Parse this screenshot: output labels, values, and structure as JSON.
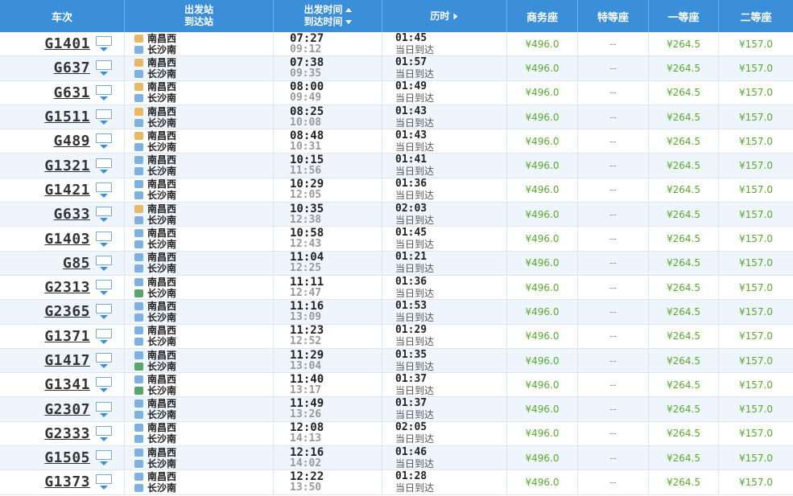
{
  "headers": {
    "train": "车次",
    "stations_from": "出发站",
    "stations_to": "到达站",
    "time_dep": "出发时间",
    "time_arr": "到达时间",
    "duration": "历时",
    "business": "商务座",
    "special": "特等座",
    "first": "一等座",
    "second": "二等座"
  },
  "icons": {
    "info": "train-info-icon",
    "sort_up": "sort-up-icon",
    "sort_down": "sort-down-icon",
    "station_badge": "station-badge-icon"
  },
  "colors": {
    "header_bg": "#3a8fd8",
    "price_green": "#5aa832",
    "start_badge": "#e8b866",
    "pass_badge": "#7fb1e0",
    "end_badge": "#5aa36a"
  },
  "rows": [
    {
      "train": "G1401",
      "from": "南昌西",
      "from_type": "start",
      "to": "长沙南",
      "to_type": "pass",
      "dep": "07:27",
      "arr": "09:12",
      "dur": "01:45",
      "note": "当日到达",
      "business": "¥496.0",
      "special": "--",
      "first": "¥264.5",
      "second": "¥157.0"
    },
    {
      "train": "G637",
      "from": "南昌西",
      "from_type": "start",
      "to": "长沙南",
      "to_type": "pass",
      "dep": "07:38",
      "arr": "09:35",
      "dur": "01:57",
      "note": "当日到达",
      "business": "¥496.0",
      "special": "--",
      "first": "¥264.5",
      "second": "¥157.0"
    },
    {
      "train": "G631",
      "from": "南昌西",
      "from_type": "start",
      "to": "长沙南",
      "to_type": "pass",
      "dep": "08:00",
      "arr": "09:49",
      "dur": "01:49",
      "note": "当日到达",
      "business": "¥496.0",
      "special": "--",
      "first": "¥264.5",
      "second": "¥157.0"
    },
    {
      "train": "G1511",
      "from": "南昌西",
      "from_type": "start",
      "to": "长沙南",
      "to_type": "pass",
      "dep": "08:25",
      "arr": "10:08",
      "dur": "01:43",
      "note": "当日到达",
      "business": "¥496.0",
      "special": "--",
      "first": "¥264.5",
      "second": "¥157.0"
    },
    {
      "train": "G489",
      "from": "南昌西",
      "from_type": "start",
      "to": "长沙南",
      "to_type": "pass",
      "dep": "08:48",
      "arr": "10:31",
      "dur": "01:43",
      "note": "当日到达",
      "business": "¥496.0",
      "special": "--",
      "first": "¥264.5",
      "second": "¥157.0"
    },
    {
      "train": "G1321",
      "from": "南昌西",
      "from_type": "pass",
      "to": "长沙南",
      "to_type": "pass",
      "dep": "10:15",
      "arr": "11:56",
      "dur": "01:41",
      "note": "当日到达",
      "business": "¥496.0",
      "special": "--",
      "first": "¥264.5",
      "second": "¥157.0"
    },
    {
      "train": "G1421",
      "from": "南昌西",
      "from_type": "pass",
      "to": "长沙南",
      "to_type": "pass",
      "dep": "10:29",
      "arr": "12:05",
      "dur": "01:36",
      "note": "当日到达",
      "business": "¥496.0",
      "special": "--",
      "first": "¥264.5",
      "second": "¥157.0"
    },
    {
      "train": "G633",
      "from": "南昌西",
      "from_type": "start",
      "to": "长沙南",
      "to_type": "pass",
      "dep": "10:35",
      "arr": "12:38",
      "dur": "02:03",
      "note": "当日到达",
      "business": "¥496.0",
      "special": "--",
      "first": "¥264.5",
      "second": "¥157.0"
    },
    {
      "train": "G1403",
      "from": "南昌西",
      "from_type": "pass",
      "to": "长沙南",
      "to_type": "pass",
      "dep": "10:58",
      "arr": "12:43",
      "dur": "01:45",
      "note": "当日到达",
      "business": "¥496.0",
      "special": "--",
      "first": "¥264.5",
      "second": "¥157.0"
    },
    {
      "train": "G85",
      "from": "南昌西",
      "from_type": "pass",
      "to": "长沙南",
      "to_type": "pass",
      "dep": "11:04",
      "arr": "12:25",
      "dur": "01:21",
      "note": "当日到达",
      "business": "¥496.0",
      "special": "--",
      "first": "¥264.5",
      "second": "¥157.0"
    },
    {
      "train": "G2313",
      "from": "南昌西",
      "from_type": "pass",
      "to": "长沙南",
      "to_type": "end",
      "dep": "11:11",
      "arr": "12:47",
      "dur": "01:36",
      "note": "当日到达",
      "business": "¥496.0",
      "special": "--",
      "first": "¥264.5",
      "second": "¥157.0"
    },
    {
      "train": "G2365",
      "from": "南昌西",
      "from_type": "pass",
      "to": "长沙南",
      "to_type": "pass",
      "dep": "11:16",
      "arr": "13:09",
      "dur": "01:53",
      "note": "当日到达",
      "business": "¥496.0",
      "special": "--",
      "first": "¥264.5",
      "second": "¥157.0"
    },
    {
      "train": "G1371",
      "from": "南昌西",
      "from_type": "pass",
      "to": "长沙南",
      "to_type": "pass",
      "dep": "11:23",
      "arr": "12:52",
      "dur": "01:29",
      "note": "当日到达",
      "business": "¥496.0",
      "special": "--",
      "first": "¥264.5",
      "second": "¥157.0"
    },
    {
      "train": "G1417",
      "from": "南昌西",
      "from_type": "pass",
      "to": "长沙南",
      "to_type": "end",
      "dep": "11:29",
      "arr": "13:04",
      "dur": "01:35",
      "note": "当日到达",
      "business": "¥496.0",
      "special": "--",
      "first": "¥264.5",
      "second": "¥157.0"
    },
    {
      "train": "G1341",
      "from": "南昌西",
      "from_type": "pass",
      "to": "长沙南",
      "to_type": "end",
      "dep": "11:40",
      "arr": "13:17",
      "dur": "01:37",
      "note": "当日到达",
      "business": "¥496.0",
      "special": "--",
      "first": "¥264.5",
      "second": "¥157.0"
    },
    {
      "train": "G2307",
      "from": "南昌西",
      "from_type": "pass",
      "to": "长沙南",
      "to_type": "pass",
      "dep": "11:49",
      "arr": "13:26",
      "dur": "01:37",
      "note": "当日到达",
      "business": "¥496.0",
      "special": "--",
      "first": "¥264.5",
      "second": "¥157.0"
    },
    {
      "train": "G2333",
      "from": "南昌西",
      "from_type": "pass",
      "to": "长沙南",
      "to_type": "pass",
      "dep": "12:08",
      "arr": "14:13",
      "dur": "02:05",
      "note": "当日到达",
      "business": "¥496.0",
      "special": "--",
      "first": "¥264.5",
      "second": "¥157.0"
    },
    {
      "train": "G1505",
      "from": "南昌西",
      "from_type": "pass",
      "to": "长沙南",
      "to_type": "pass",
      "dep": "12:16",
      "arr": "14:02",
      "dur": "01:46",
      "note": "当日到达",
      "business": "¥496.0",
      "special": "--",
      "first": "¥264.5",
      "second": "¥157.0"
    },
    {
      "train": "G1373",
      "from": "南昌西",
      "from_type": "pass",
      "to": "长沙南",
      "to_type": "pass",
      "dep": "12:22",
      "arr": "13:50",
      "dur": "01:28",
      "note": "当日到达",
      "business": "¥496.0",
      "special": "--",
      "first": "¥264.5",
      "second": "¥157.0"
    }
  ]
}
